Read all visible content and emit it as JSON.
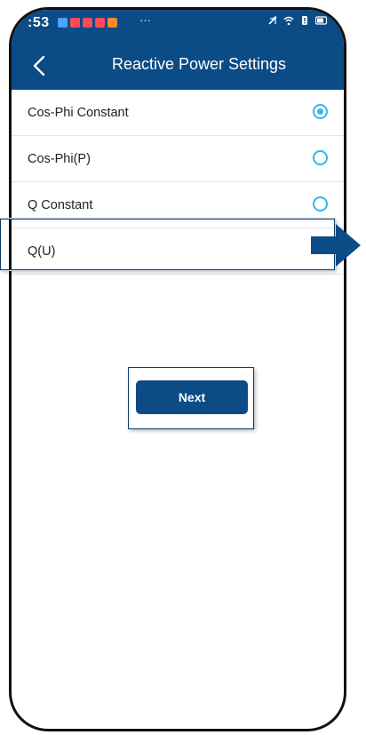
{
  "status_bar": {
    "time": ":53",
    "more_indicator": "···",
    "notification_colors": [
      "#4aa3ff",
      "#ff4b57",
      "#ff4b57",
      "#ff4b57",
      "#ff8a2a"
    ]
  },
  "app_bar": {
    "title": "Reactive Power Settings",
    "back_icon": "chevron-left-icon"
  },
  "options": [
    {
      "label": "Cos-Phi Constant",
      "selected": true
    },
    {
      "label": "Cos-Phi(P)",
      "selected": false
    },
    {
      "label": "Q Constant",
      "selected": false
    },
    {
      "label": "Q(U)",
      "selected": false
    }
  ],
  "next_button": {
    "label": "Next"
  },
  "colors": {
    "primary": "#0b4b86",
    "radio_accent": "#2fb8ee",
    "annotation_arrow": "#0b4b86"
  }
}
